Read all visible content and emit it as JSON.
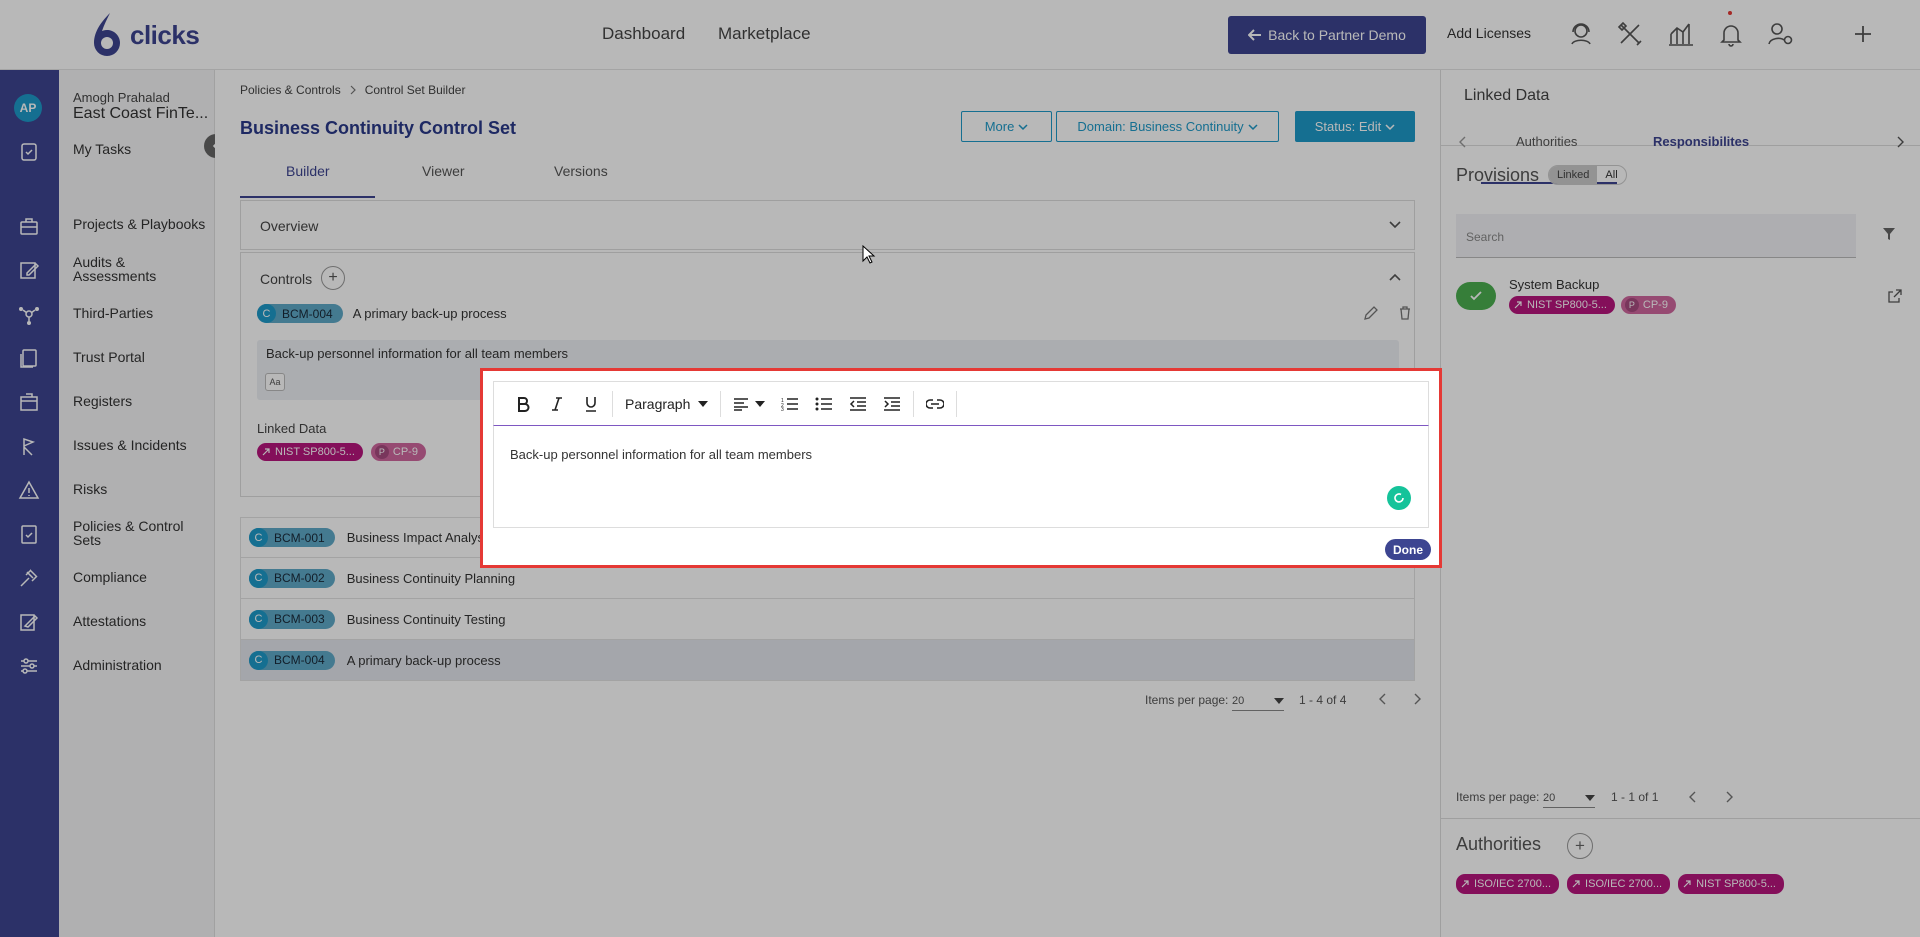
{
  "topbar": {
    "logo_text": "clicks",
    "nav": [
      "Dashboard",
      "Marketplace"
    ],
    "back_button": "Back to Partner Demo",
    "add_licenses": "Add Licenses"
  },
  "user": {
    "initials": "AP",
    "name": "Amogh Prahalad",
    "org": "East Coast FinTe..."
  },
  "nav_items": [
    "My Tasks",
    "Projects & Playbooks",
    "Audits & Assessments",
    "Third-Parties",
    "Trust Portal",
    "Registers",
    "Issues & Incidents",
    "Risks",
    "Policies & Control Sets",
    "Compliance",
    "Attestations",
    "Administration"
  ],
  "breadcrumb": [
    "Policies & Controls",
    "Control Set Builder"
  ],
  "page": {
    "title": "Business Continuity Control Set",
    "more_btn": "More",
    "domain_btn": "Domain: Business Continuity",
    "status_btn": "Status: Edit",
    "tabs": [
      "Builder",
      "Viewer",
      "Versions"
    ]
  },
  "overview_label": "Overview",
  "controls": {
    "label": "Controls",
    "badge_letter": "C",
    "expanded": {
      "code": "BCM-004",
      "name": "A primary back-up process",
      "description": "Back-up personnel information for all team members",
      "aa": "Aa",
      "linked_label": "Linked Data",
      "tags": [
        {
          "kind": "nist",
          "text": "NIST SP800-5..."
        },
        {
          "kind": "p",
          "letter": "P",
          "text": "CP-9"
        }
      ]
    },
    "rows": [
      {
        "code": "BCM-001",
        "name": "Business Impact Analysis"
      },
      {
        "code": "BCM-002",
        "name": "Business Continuity Planning"
      },
      {
        "code": "BCM-003",
        "name": "Business Continuity Testing"
      },
      {
        "code": "BCM-004",
        "name": "A primary back-up process"
      }
    ]
  },
  "pager": {
    "label": "Items per page:",
    "per_page": "20",
    "range": "1 - 4 of 4"
  },
  "editor": {
    "paragraph": "Paragraph",
    "content": "Back-up personnel information for all team members",
    "done": "Done"
  },
  "right_panel": {
    "title": "Linked Data",
    "tabs": [
      "Authorities",
      "Responsibilites"
    ],
    "provisions_title": "Provisions",
    "toggle": [
      "Linked",
      "All"
    ],
    "search_placeholder": "Search",
    "provision": {
      "name": "System Backup",
      "tag1": "NIST SP800-5...",
      "tag2_letter": "P",
      "tag2": "CP-9"
    },
    "pager": {
      "label": "Items per page:",
      "per_page": "20",
      "range": "1 - 1 of 1"
    },
    "authorities_title": "Authorities",
    "authority_tags": [
      "ISO/IEC 2700...",
      "ISO/IEC 2700...",
      "NIST SP800-5..."
    ]
  },
  "colors": {
    "brand": "#3d4591",
    "accent": "#1e9ac9",
    "nist_tag": "#b8157d",
    "highlight_border": "#e53935"
  }
}
